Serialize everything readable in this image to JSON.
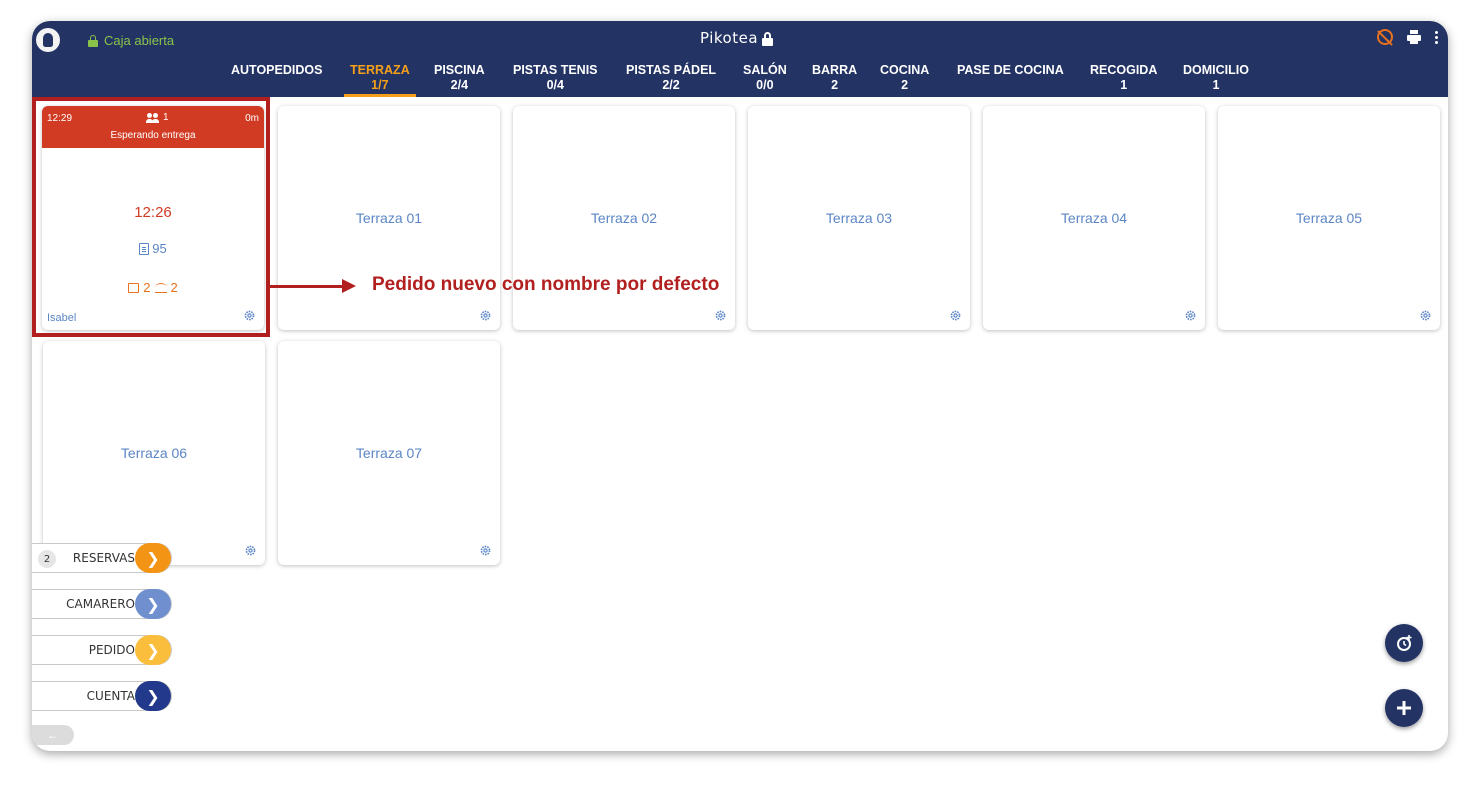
{
  "topbar": {
    "cash_status": "Caja abierta",
    "brand": "Pikotea",
    "tabs": [
      {
        "label": "AUTOPEDIDOS",
        "count": ""
      },
      {
        "label": "TERRAZA",
        "count": "1/7"
      },
      {
        "label": "PISCINA",
        "count": "2/4"
      },
      {
        "label": "PISTAS TENIS",
        "count": "0/4"
      },
      {
        "label": "PISTAS PÁDEL",
        "count": "2/2"
      },
      {
        "label": "SALÓN",
        "count": "0/0"
      },
      {
        "label": "BARRA",
        "count": "2"
      },
      {
        "label": "COCINA",
        "count": "2"
      },
      {
        "label": "PASE DE COCINA",
        "count": ""
      },
      {
        "label": "RECOGIDA",
        "count": "1"
      },
      {
        "label": "DOMICILIO",
        "count": "1"
      }
    ],
    "active_tab": "TERRAZA",
    "colors": {
      "bar": "#233364",
      "accent": "#f6a01a",
      "caja": "#8ac34a"
    }
  },
  "order_card": {
    "time": "12:29",
    "guests": "1",
    "minutes": "0m",
    "status": "Esperando entrega",
    "order_time": "12:26",
    "order_number": "95",
    "count_a": "2",
    "count_b": "2",
    "waiter": "Isabel"
  },
  "tables": [
    {
      "name": "Terraza 01"
    },
    {
      "name": "Terraza 02"
    },
    {
      "name": "Terraza 03"
    },
    {
      "name": "Terraza 04"
    },
    {
      "name": "Terraza 05"
    },
    {
      "name": "Terraza 06"
    },
    {
      "name": "Terraza 07"
    }
  ],
  "annotation": {
    "text": "Pedido nuevo con nombre por defecto",
    "color": "#b21f1f"
  },
  "side_buttons": {
    "reservas": {
      "label": "RESERVAS",
      "badge": "2",
      "color": "#f39414"
    },
    "camarero": {
      "label": "CAMARERO",
      "color": "#6f8fcf"
    },
    "pedido": {
      "label": "PEDIDO",
      "color": "#fbbd3c"
    },
    "cuenta": {
      "label": "CUENTA",
      "color": "#233a8c"
    }
  }
}
